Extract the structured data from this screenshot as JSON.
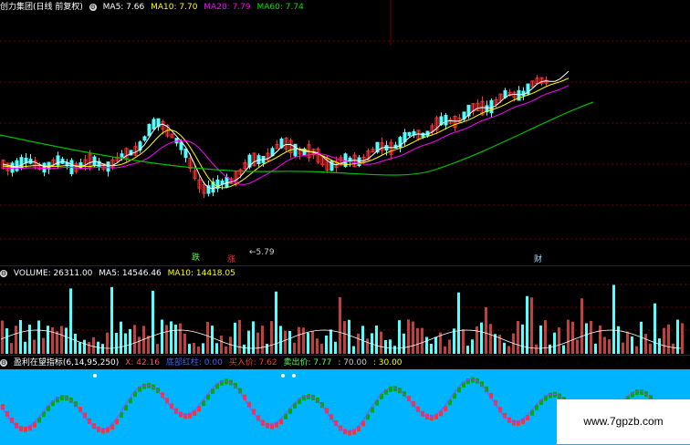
{
  "price_pane": {
    "title": "创力集团(日线 前复权)",
    "ma5": "MA5: 7.66",
    "ma10": "MA10: 7.70",
    "ma20": "MA20: 7.79",
    "ma60": "MA60: 7.74",
    "low_label": "←5.79",
    "marker_die": "跌",
    "marker_zhang": "涨",
    "marker_cai": "财"
  },
  "volume_pane": {
    "title": "VOLUME: 26311.00",
    "ma5": "MA5: 14546.46",
    "ma10": "MA10: 14418.05"
  },
  "indicator_pane": {
    "title": "盈利在望指标(6,14,95,250)",
    "x": "X: 42.16",
    "hidden": "底部红柱: 0.00",
    "buy": "买入价: 7.62",
    "sell": "卖出价: 7.77",
    "v70": ": 70.00",
    "v30": ": 30.00"
  },
  "colors": {
    "up": "#ff3232",
    "down": "#54ffff",
    "ma5": "#ffffff",
    "ma10": "#ffff00",
    "ma20": "#ff00ff",
    "ma60": "#00c000",
    "indicator_bg": "#00b4ff"
  },
  "watermark": "www.7gpzb.com"
}
